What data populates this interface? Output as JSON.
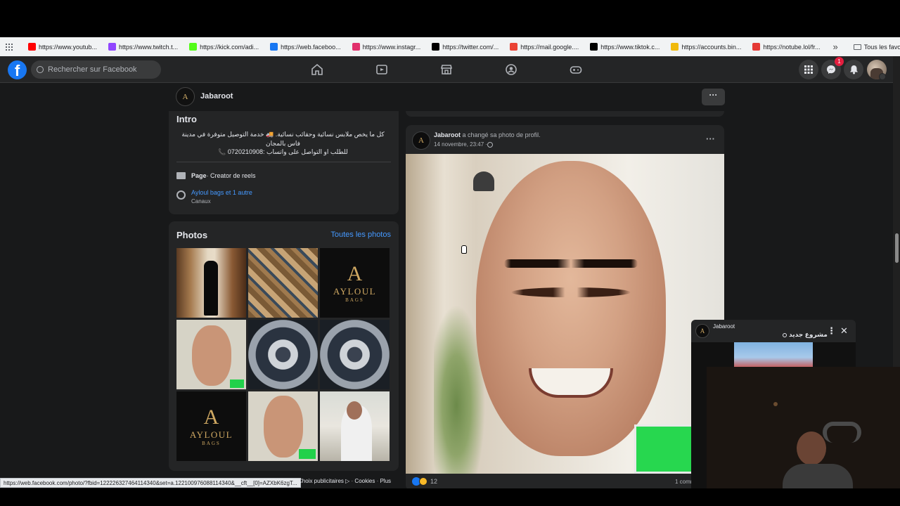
{
  "bookmarks": [
    {
      "label": "https://www.youtub...",
      "color": "#ff0000"
    },
    {
      "label": "https://www.twitch.t...",
      "color": "#9146ff"
    },
    {
      "label": "https://kick.com/adi...",
      "color": "#53fc18"
    },
    {
      "label": "https://web.faceboo...",
      "color": "#1877f2"
    },
    {
      "label": "https://www.instagr...",
      "color": "#e1306c"
    },
    {
      "label": "https://twitter.com/...",
      "color": "#000000"
    },
    {
      "label": "https://mail.google....",
      "color": "#ea4335"
    },
    {
      "label": "https://www.tiktok.c...",
      "color": "#000000"
    },
    {
      "label": "https://accounts.bin...",
      "color": "#f0b90b"
    },
    {
      "label": "https://notube.lol/fr...",
      "color": "#e53935"
    }
  ],
  "bookmarks_overflow": "»",
  "all_bookmarks": "Tous les favoris",
  "header": {
    "search_placeholder": "Rechercher sur Facebook",
    "messenger_badge": "1"
  },
  "pagebar": {
    "name": "Jabaroot",
    "more": "···"
  },
  "intro": {
    "title": "Intro",
    "bio_line1": "كل ما يخص ملابس نسائية وحقائب نسائية. 🚚 خدمة التوصيل متوفرة في مدينة",
    "bio_line2": "فاس بالمجان",
    "bio_line3": "للطلب او التواصل على واتساب :0720210908 📞",
    "page_label": "Page",
    "page_category": " · Creator de reels",
    "channels_link": "Ayloul bags et 1 autre",
    "channels_sub": "Canaux"
  },
  "photos": {
    "title": "Photos",
    "all_link": "Toutes les photos",
    "logo_letter": "A",
    "logo_name": "AYLOUL",
    "logo_sub": "BAGS"
  },
  "post": {
    "author": "Jabaroot",
    "action": " a changé sa photo de profil.",
    "time": "14 novembre, 23:47 · ",
    "more": "···",
    "reactions_count": "12",
    "comments": "1 commentaire"
  },
  "popup": {
    "author": "Jabaroot",
    "title": "مشروع جديد",
    "more": "⋮",
    "close": "✕"
  },
  "status_url": "https://web.facebook.com/photo/?fbid=122226327464114340&set=a.122100976088114340&__cft__[0]=AZXbK6zgT...",
  "footer": {
    "ads": "Choix publicitaires ▷",
    "cookies": "Cookies",
    "more": "Plus"
  }
}
